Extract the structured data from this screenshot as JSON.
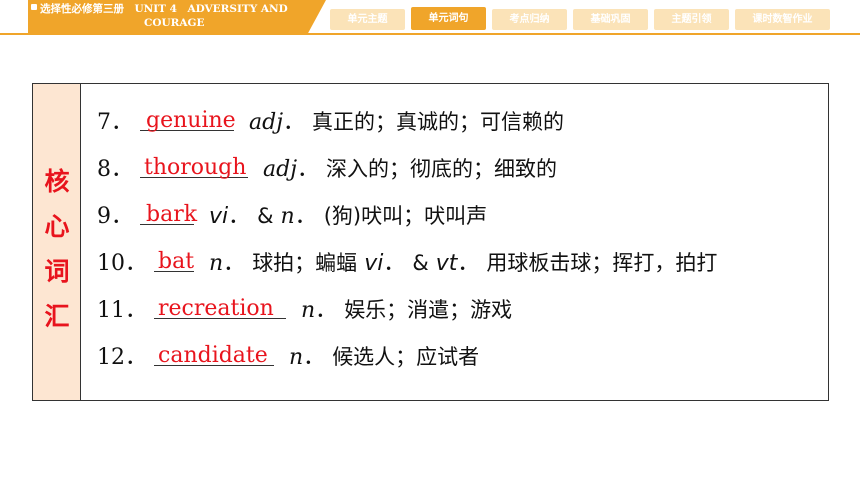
{
  "header": {
    "course_line1": "选择性必修第三册　UNIT 4　ADVERSITY AND",
    "course_line2": "COURAGE",
    "nav": [
      {
        "label": "单元主题",
        "active": false
      },
      {
        "label": "单元词句",
        "active": true
      },
      {
        "label": "考点归纳",
        "active": false
      },
      {
        "label": "基础巩固",
        "active": false
      },
      {
        "label": "主题引领",
        "active": false
      },
      {
        "label": "课时数智作业",
        "active": false
      }
    ]
  },
  "section": {
    "side_label": [
      "核",
      "心",
      "词",
      "汇"
    ]
  },
  "items": [
    {
      "num": "7．",
      "answer": "genuine",
      "pos": "adj",
      "sep": "．",
      "definition": "真正的；真诚的；可信赖的"
    },
    {
      "num": "8．",
      "answer": "thorough",
      "pos": "adj",
      "sep": "．",
      "definition": "深入的；彻底的；细致的"
    },
    {
      "num": "9．",
      "answer": "bark",
      "pos": "vi",
      "sep": "．",
      "pos2": "&",
      "pos3": "n",
      "sep2": "．",
      "definition": "(狗)吠叫；吠叫声"
    },
    {
      "num": "10．",
      "answer": "bat",
      "pos": "n",
      "sep": "．",
      "definition": "球拍；蝙蝠",
      "pos4": "vi",
      "sep4": "．",
      "amp": "&",
      "pos5": "vt",
      "sep5": "．",
      "definition2": "用球板击球；挥打，拍打"
    },
    {
      "num": "11．",
      "answer": "recreation",
      "pos": "n",
      "sep": "．",
      "definition": "娱乐；消遣；游戏"
    },
    {
      "num": "12．",
      "answer": "candidate",
      "pos": "n",
      "sep": "．",
      "definition": "候选人；应试者"
    }
  ]
}
